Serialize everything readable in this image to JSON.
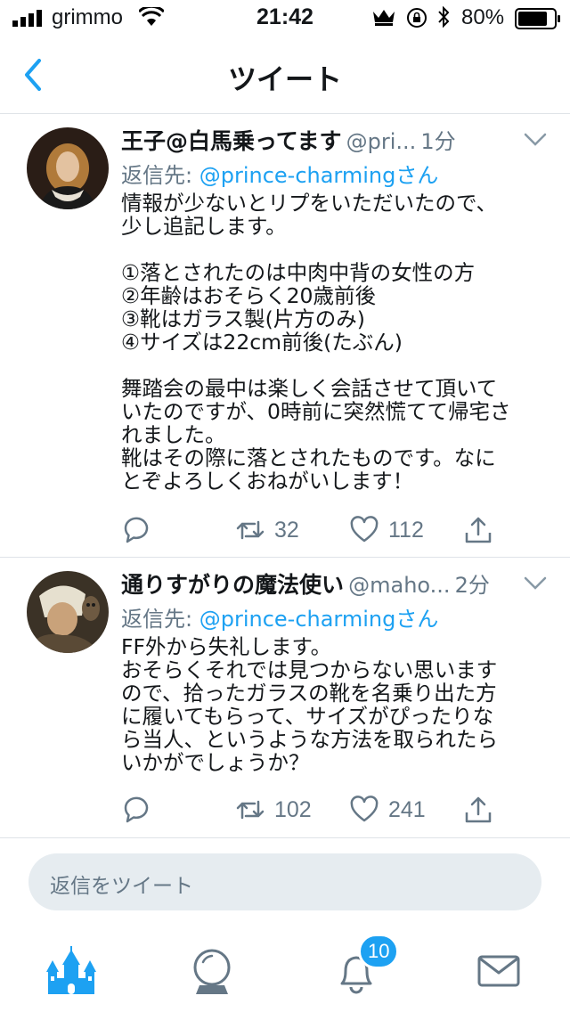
{
  "status_bar": {
    "carrier": "grimmo",
    "time": "21:42",
    "battery": "80%"
  },
  "header": {
    "title": "ツイート"
  },
  "tweets": [
    {
      "name": "王子@白馬乗ってます",
      "handle": "@pri...",
      "time": "1分",
      "reply_prefix": "返信先: ",
      "reply_to": "@prince-charmingさん",
      "body": "情報が少ないとリプをいただいたので、\n少し追記します。\n\n①落とされたのは中肉中背の女性の方\n②年齢はおそらく20歳前後\n③靴はガラス製(片方のみ)\n④サイズは22cm前後(たぶん)\n\n舞踏会の最中は楽しく会話させて頂いていたのですが、0時前に突然慌てて帰宅されました。\n靴はその際に落とされたものです。なにとぞよろしくおねがいします！",
      "retweets": "32",
      "likes": "112"
    },
    {
      "name": "通りすがりの魔法使い",
      "handle": "@maho...",
      "time": "2分",
      "reply_prefix": "返信先: ",
      "reply_to": "@prince-charmingさん",
      "body": "FF外から失礼します。\nおそらくそれでは見つからない思いますので、拾ったガラスの靴を名乗り出た方に履いてもらって、サイズがぴったりなら当人、というような方法を取られたらいかがでしょうか？",
      "retweets": "102",
      "likes": "241"
    }
  ],
  "composer": {
    "placeholder": "返信をツイート"
  },
  "tab_bar": {
    "items": [
      "castle-home-icon",
      "crystal-ball-search-icon",
      "bell-notifications-icon",
      "envelope-messages-icon"
    ],
    "notification_count": "10"
  },
  "colors": {
    "accent": "#1da1f2",
    "secondary_text": "#657786",
    "divider": "#dfe3e8",
    "composer_bg": "#e6ecf0"
  }
}
